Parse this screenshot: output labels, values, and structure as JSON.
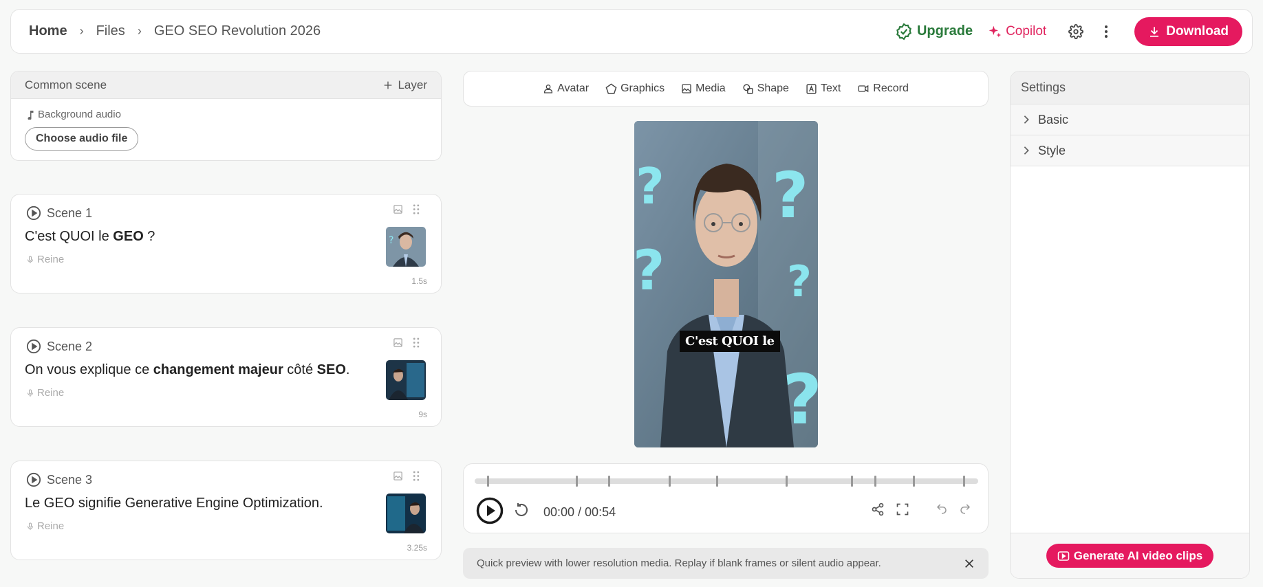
{
  "breadcrumb": {
    "home": "Home",
    "files": "Files",
    "project": "GEO SEO Revolution 2026"
  },
  "header": {
    "upgrade": "Upgrade",
    "copilot": "Copilot",
    "download": "Download"
  },
  "common_scene": {
    "title": "Common scene",
    "layer_label": "Layer",
    "background_audio": "Background audio",
    "choose_audio": "Choose audio file"
  },
  "scenes": [
    {
      "title": "Scene 1",
      "voice": "Reine",
      "duration": "1.5s",
      "text_parts": [
        "C'est QUOI le ",
        "GEO",
        " ?"
      ]
    },
    {
      "title": "Scene 2",
      "voice": "Reine",
      "duration": "9s",
      "text_parts": [
        "On vous explique ce ",
        "changement majeur",
        " côté ",
        "SEO",
        "."
      ]
    },
    {
      "title": "Scene 3",
      "voice": "Reine",
      "duration": "3.25s",
      "text_parts": [
        "Le GEO signifie Generative Engine Optimization."
      ]
    }
  ],
  "toolbar": {
    "avatar": "Avatar",
    "graphics": "Graphics",
    "media": "Media",
    "shape": "Shape",
    "text": "Text",
    "record": "Record"
  },
  "preview": {
    "caption": "C'est QUOI le"
  },
  "player": {
    "time": "00:00 / 00:54"
  },
  "notice": {
    "text": "Quick preview with lower resolution media. Replay if blank frames or silent audio appear."
  },
  "settings": {
    "title": "Settings",
    "basic": "Basic",
    "style": "Style",
    "generate": "Generate AI video clips"
  },
  "colors": {
    "accent": "#e5195f",
    "upgrade": "#2a7a3b"
  }
}
